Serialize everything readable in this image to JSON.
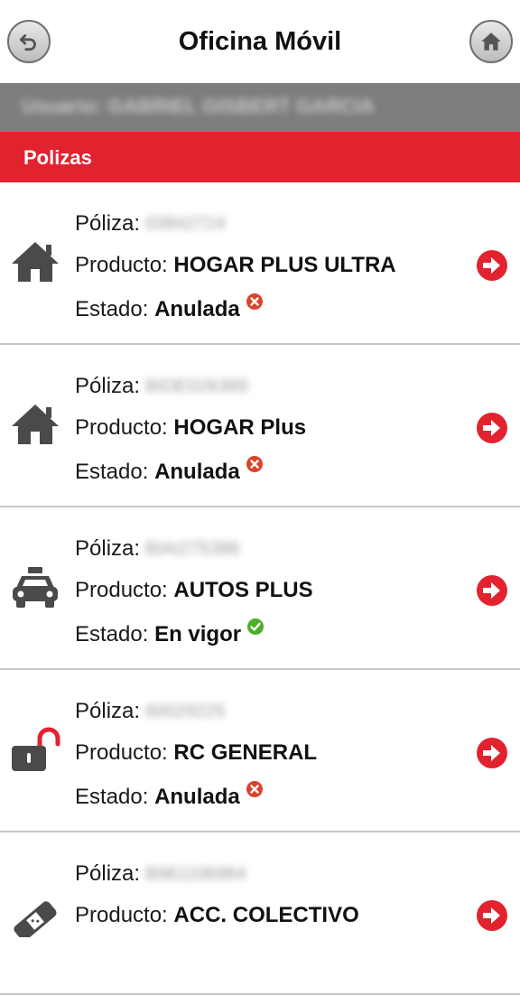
{
  "header": {
    "title": "Oficina Móvil",
    "back_icon": "back-arrow-icon",
    "home_icon": "home-icon"
  },
  "user_bar": {
    "text": "Usuario: GABRIEL GISBERT GARCIA"
  },
  "section": {
    "title": "Polizas"
  },
  "labels": {
    "poliza": "Póliza:",
    "producto": "Producto:",
    "estado": "Estado:"
  },
  "colors": {
    "accent": "#e2222e",
    "ok": "#4caf2a",
    "cancelled": "#d9452b"
  },
  "policies": [
    {
      "number": "03842724",
      "product": "HOGAR PLUS ULTRA",
      "status": "Anulada",
      "status_icon": "cancelled-icon",
      "kind_icon": "house-icon"
    },
    {
      "number": "BIDE026389",
      "product": "HOGAR Plus",
      "status": "Anulada",
      "status_icon": "cancelled-icon",
      "kind_icon": "house-icon"
    },
    {
      "number": "BIAI275386",
      "product": "AUTOS PLUS",
      "status": "En vigor",
      "status_icon": "active-icon",
      "kind_icon": "car-icon"
    },
    {
      "number": "60029225",
      "product": "RC GENERAL",
      "status": "Anulada",
      "status_icon": "cancelled-icon",
      "kind_icon": "open-lock-icon"
    },
    {
      "number": "B961106964",
      "product": "ACC. COLECTIVO",
      "status": "",
      "status_icon": "",
      "kind_icon": "bandage-icon"
    }
  ]
}
